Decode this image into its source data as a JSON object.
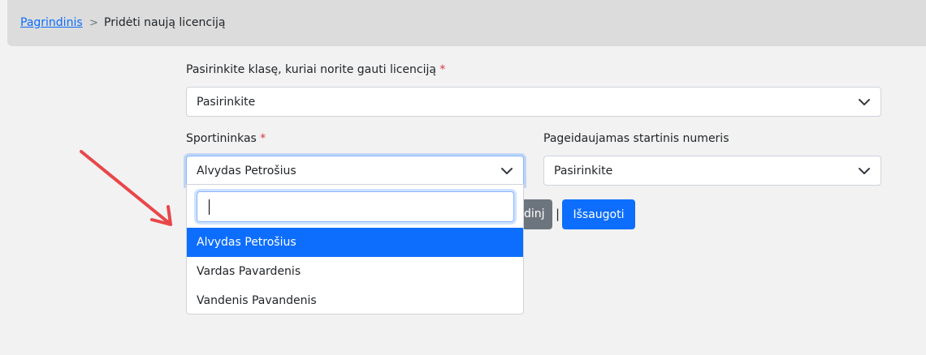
{
  "breadcrumb": {
    "home": "Pagrindinis",
    "separator": ">",
    "current": "Pridėti naują licenciją"
  },
  "form": {
    "class_label": "Pasirinkite klasę, kuriai norite gauti licenciją",
    "required_mark": "*",
    "class_select_value": "Pasirinkite",
    "athlete_label": "Sportininkas",
    "athlete_select_value": "Alvydas Petrošius",
    "start_number_label": "Pageidaujamas startinis numeris",
    "start_number_value": "Pasirinkite",
    "grey_button_label": "dinj",
    "divider": "|",
    "save_button_label": "Išsaugoti"
  },
  "dropdown": {
    "search_value": "",
    "options": [
      "Alvydas Petrošius",
      "Vardas Pavardenis",
      "Vandenis Pavandenis"
    ],
    "selected": "Alvydas Petrošius"
  },
  "colors": {
    "accent": "#0d6efd",
    "required": "#dc3545",
    "annotation_arrow": "#e8474a"
  }
}
